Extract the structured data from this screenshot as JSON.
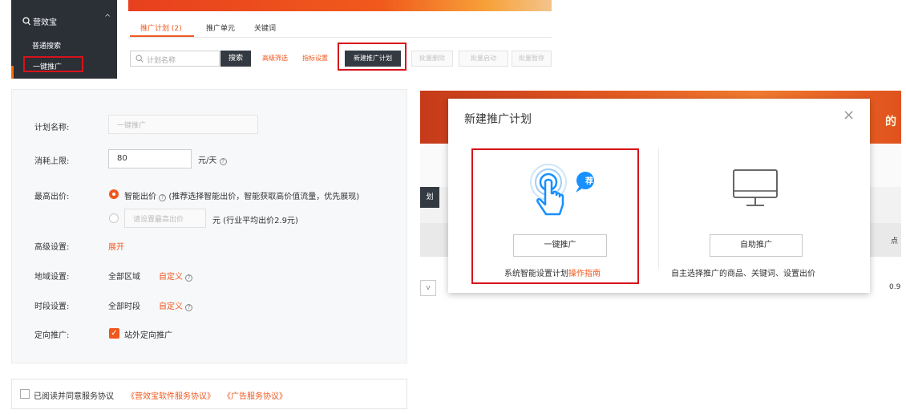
{
  "sidebar": {
    "title": "营效宝",
    "items": [
      {
        "label": "普通搜索"
      },
      {
        "label": "一键推广"
      }
    ]
  },
  "tabs": [
    {
      "label": "推广计划 (2)",
      "active": true
    },
    {
      "label": "推广单元",
      "active": false
    },
    {
      "label": "关键词",
      "active": false
    }
  ],
  "toolbar": {
    "search_placeholder": "计划名称",
    "search_label": "搜索",
    "advanced_filter": "高级筛选",
    "indicator_settings": "指标设置",
    "new_plan": "新建推广计划",
    "batch_delete": "批量删除",
    "batch_enable": "批量启动",
    "batch_pause": "批量暂停"
  },
  "form": {
    "name_label": "计划名称:",
    "name_placeholder": "一键推广",
    "budget_label": "消耗上限:",
    "budget_value": "80",
    "budget_unit": "元/天",
    "bid_label": "最高出价:",
    "smart_bid_text": "智能出价",
    "smart_bid_note": "(推荐选择智能出价，智能获取高价值流量，优先展现)",
    "manual_bid_placeholder": "请设置最高出价",
    "manual_bid_unit": "元 (行业平均出价2.9元)",
    "advanced_label": "高级设置:",
    "advanced_link": "展开",
    "region_label": "地域设置:",
    "region_value": "全部区域",
    "region_link": "自定义",
    "time_label": "时段设置:",
    "time_value": "全部时段",
    "time_link": "自定义",
    "targeting_label": "定向推广:",
    "targeting_option": "站外定向推广",
    "targeting_checked": true
  },
  "agreement": {
    "text": "已阅读并同意服务协议",
    "link1": "《营效宝软件服务协议》",
    "link2": "《广告服务协议》"
  },
  "background": {
    "banner_text": "的",
    "button_text": "划",
    "column_header": "点",
    "cell_value": "0.9"
  },
  "modal": {
    "title": "新建推广计划",
    "close": "×",
    "option1": {
      "badge": "荐",
      "button": "一键推广",
      "desc": "系统智能设置计划",
      "desc_link": "操作指南"
    },
    "option2": {
      "button": "自助推广",
      "desc": "自主选择推广的商品、关键词、设置出价"
    }
  },
  "colors": {
    "accent": "#f0581e",
    "highlight": "#d8121b",
    "dark_button": "#333a42",
    "sidebar": "#2b2f36",
    "tap_icon": "#1890ff"
  }
}
